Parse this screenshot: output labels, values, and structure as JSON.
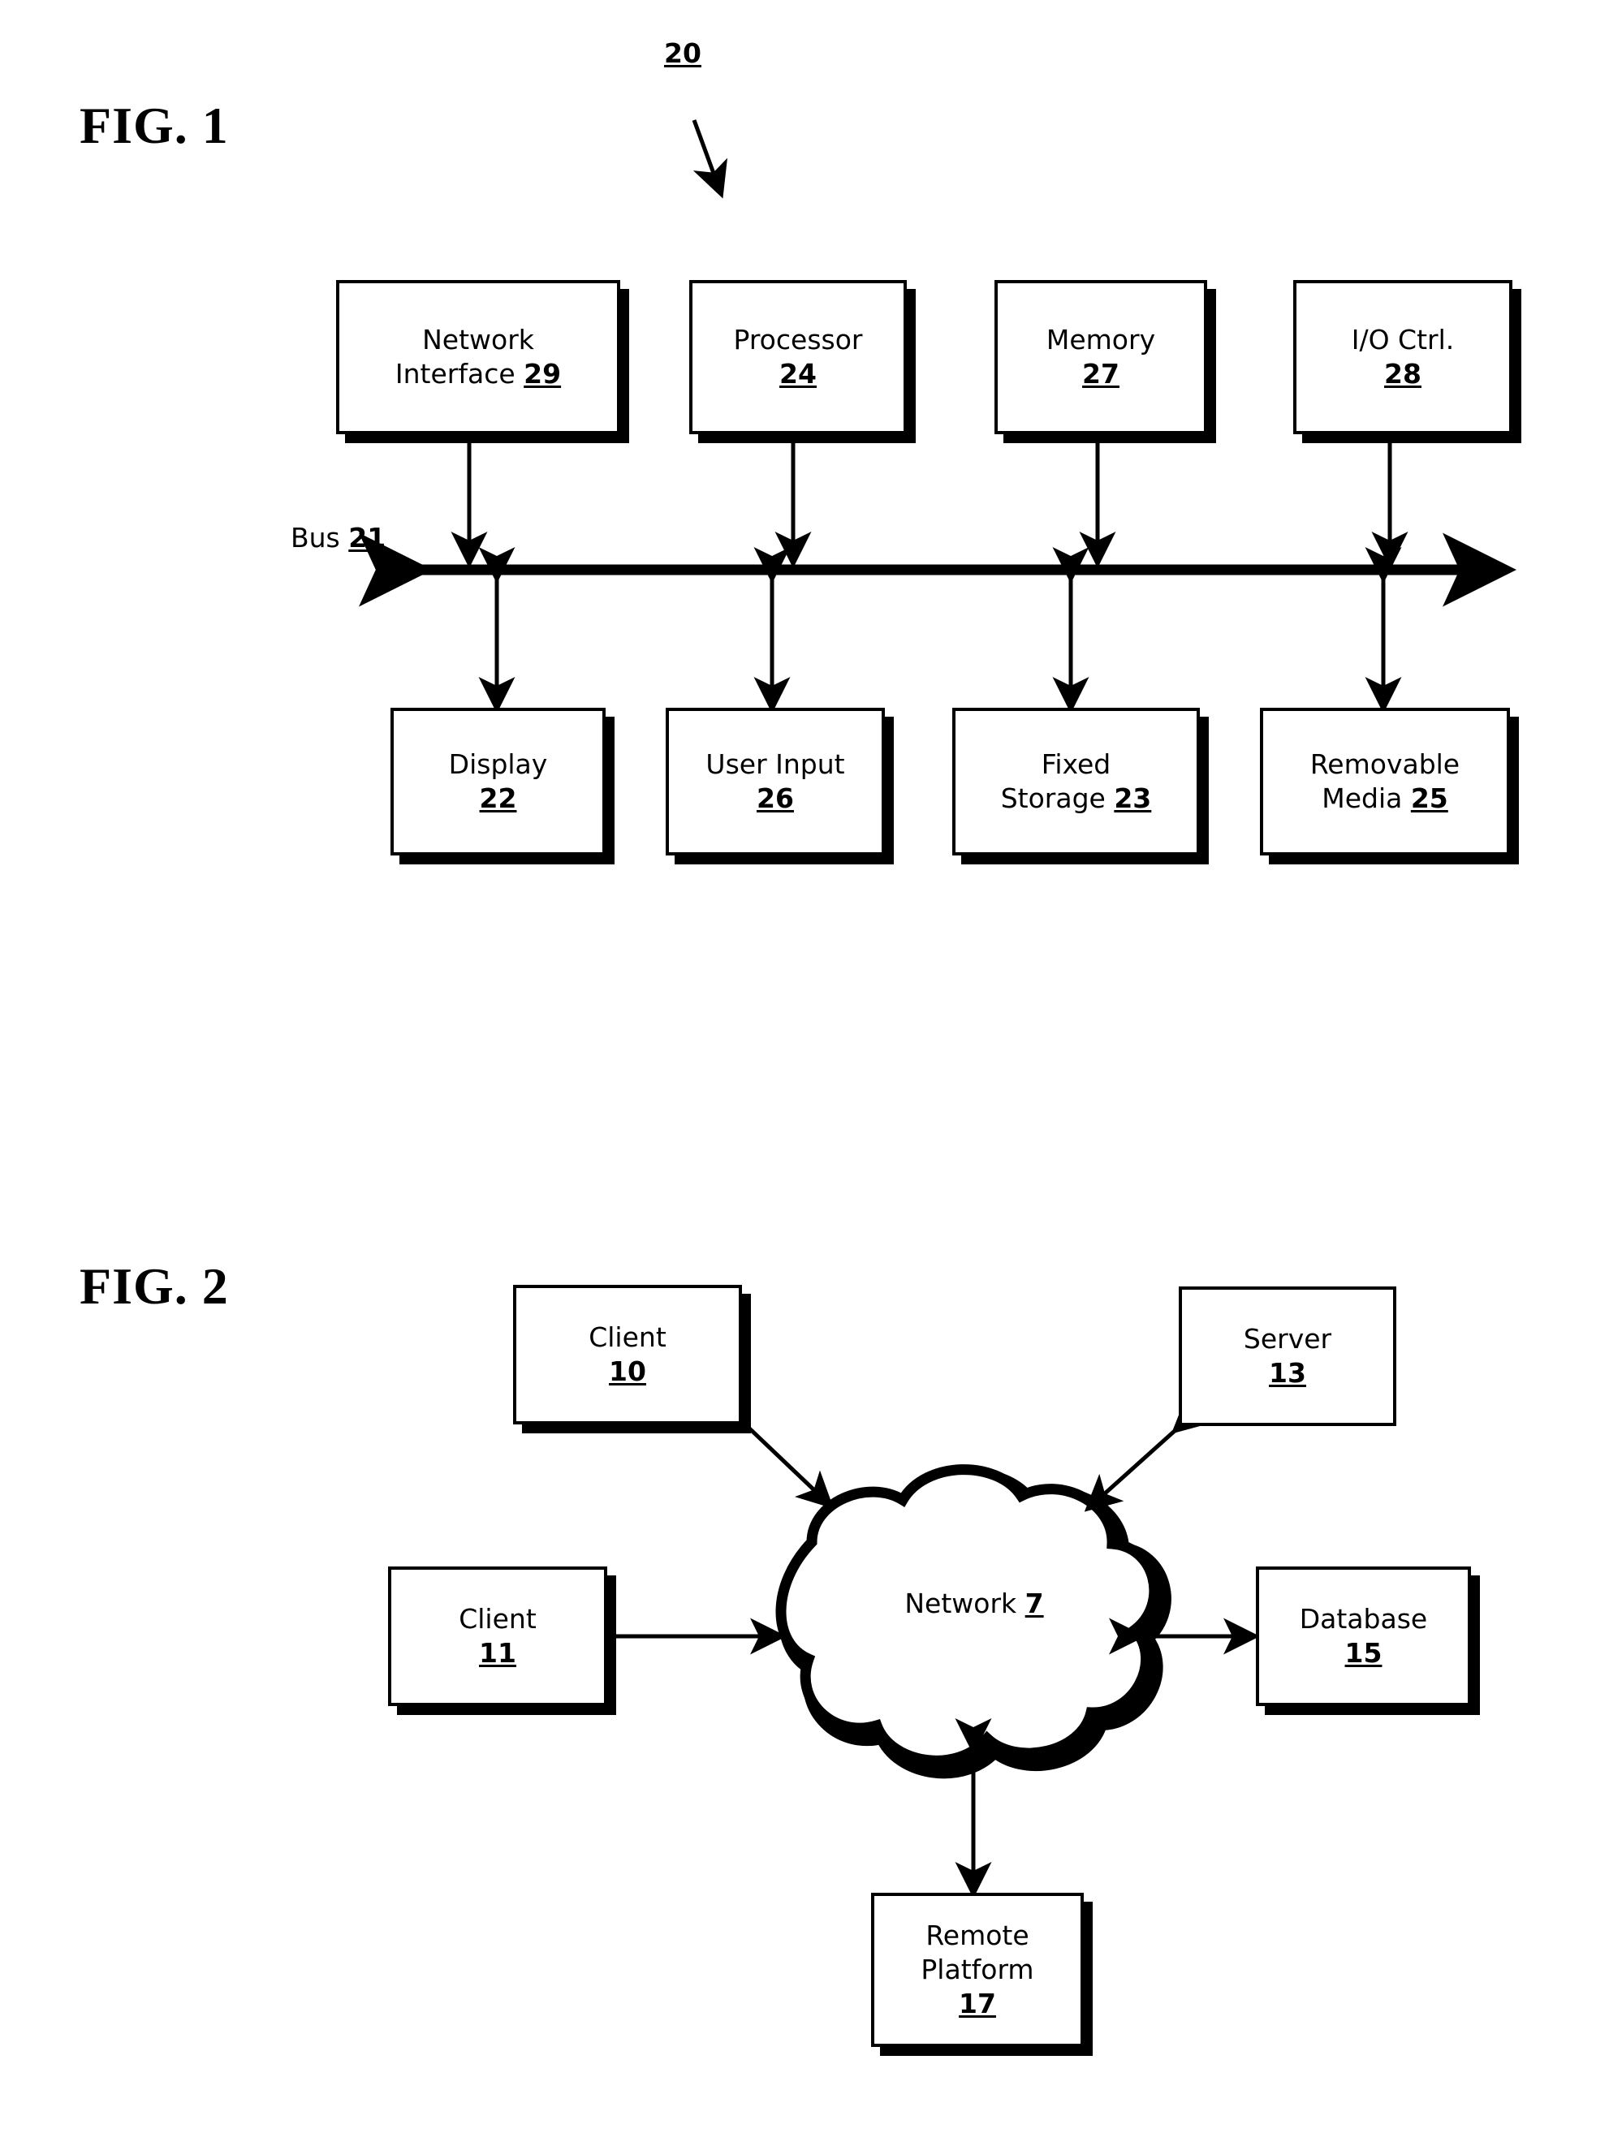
{
  "document": {
    "type": "patent-figure-sheet",
    "figures": [
      {
        "id": "fig1",
        "label": "FIG. 1",
        "callout": "20"
      },
      {
        "id": "fig2",
        "label": "FIG. 2"
      }
    ]
  },
  "fig1": {
    "label": "FIG. 1",
    "callout": "20",
    "bus": {
      "name": "Bus",
      "ref": "21"
    },
    "top_nodes": [
      {
        "name": "Network",
        "name2": "Interface",
        "ref": "29",
        "inline_ref": true
      },
      {
        "name": "Processor",
        "ref": "24",
        "inline_ref": false
      },
      {
        "name": "Memory",
        "ref": "27",
        "inline_ref": false
      },
      {
        "name": "I/O Ctrl.",
        "ref": "28",
        "inline_ref": false
      }
    ],
    "bottom_nodes": [
      {
        "name": "Display",
        "ref": "22",
        "inline_ref": false
      },
      {
        "name": "User Input",
        "ref": "26",
        "inline_ref": false
      },
      {
        "name": "Fixed",
        "name2": "Storage",
        "ref": "23",
        "inline_ref": true
      },
      {
        "name": "Removable",
        "name2": "Media",
        "ref": "25",
        "inline_ref": true
      }
    ]
  },
  "fig2": {
    "label": "FIG. 2",
    "cloud": {
      "name": "Network",
      "ref": "7"
    },
    "nodes": [
      {
        "id": "client10",
        "name": "Client",
        "ref": "10"
      },
      {
        "id": "server13",
        "name": "Server",
        "ref": "13"
      },
      {
        "id": "client11",
        "name": "Client",
        "ref": "11"
      },
      {
        "id": "database15",
        "name": "Database",
        "ref": "15"
      },
      {
        "id": "remote17",
        "name": "Remote",
        "name2": "Platform",
        "ref": "17"
      }
    ],
    "connections": [
      {
        "from": "client10",
        "to": "cloud",
        "style": "double-arrow"
      },
      {
        "from": "server13",
        "to": "cloud",
        "style": "double-arrow"
      },
      {
        "from": "client11",
        "to": "cloud",
        "style": "double-arrow"
      },
      {
        "from": "database15",
        "to": "cloud",
        "style": "double-arrow"
      },
      {
        "from": "remote17",
        "to": "cloud",
        "style": "double-arrow"
      }
    ]
  },
  "colors": {
    "ink": "#000000",
    "paper": "#ffffff"
  }
}
